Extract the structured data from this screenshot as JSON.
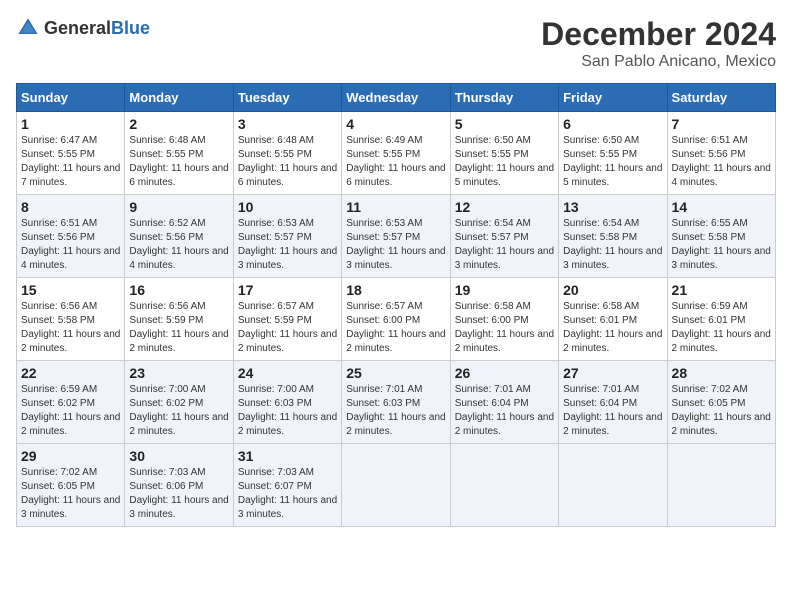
{
  "header": {
    "logo_general": "General",
    "logo_blue": "Blue",
    "month_title": "December 2024",
    "location": "San Pablo Anicano, Mexico"
  },
  "calendar": {
    "days_of_week": [
      "Sunday",
      "Monday",
      "Tuesday",
      "Wednesday",
      "Thursday",
      "Friday",
      "Saturday"
    ],
    "weeks": [
      [
        {
          "day": "1",
          "sunrise": "6:47 AM",
          "sunset": "5:55 PM",
          "daylight": "11 hours and 7 minutes."
        },
        {
          "day": "2",
          "sunrise": "6:48 AM",
          "sunset": "5:55 PM",
          "daylight": "11 hours and 6 minutes."
        },
        {
          "day": "3",
          "sunrise": "6:48 AM",
          "sunset": "5:55 PM",
          "daylight": "11 hours and 6 minutes."
        },
        {
          "day": "4",
          "sunrise": "6:49 AM",
          "sunset": "5:55 PM",
          "daylight": "11 hours and 6 minutes."
        },
        {
          "day": "5",
          "sunrise": "6:50 AM",
          "sunset": "5:55 PM",
          "daylight": "11 hours and 5 minutes."
        },
        {
          "day": "6",
          "sunrise": "6:50 AM",
          "sunset": "5:55 PM",
          "daylight": "11 hours and 5 minutes."
        },
        {
          "day": "7",
          "sunrise": "6:51 AM",
          "sunset": "5:56 PM",
          "daylight": "11 hours and 4 minutes."
        }
      ],
      [
        {
          "day": "8",
          "sunrise": "6:51 AM",
          "sunset": "5:56 PM",
          "daylight": "11 hours and 4 minutes."
        },
        {
          "day": "9",
          "sunrise": "6:52 AM",
          "sunset": "5:56 PM",
          "daylight": "11 hours and 4 minutes."
        },
        {
          "day": "10",
          "sunrise": "6:53 AM",
          "sunset": "5:57 PM",
          "daylight": "11 hours and 3 minutes."
        },
        {
          "day": "11",
          "sunrise": "6:53 AM",
          "sunset": "5:57 PM",
          "daylight": "11 hours and 3 minutes."
        },
        {
          "day": "12",
          "sunrise": "6:54 AM",
          "sunset": "5:57 PM",
          "daylight": "11 hours and 3 minutes."
        },
        {
          "day": "13",
          "sunrise": "6:54 AM",
          "sunset": "5:58 PM",
          "daylight": "11 hours and 3 minutes."
        },
        {
          "day": "14",
          "sunrise": "6:55 AM",
          "sunset": "5:58 PM",
          "daylight": "11 hours and 3 minutes."
        }
      ],
      [
        {
          "day": "15",
          "sunrise": "6:56 AM",
          "sunset": "5:58 PM",
          "daylight": "11 hours and 2 minutes."
        },
        {
          "day": "16",
          "sunrise": "6:56 AM",
          "sunset": "5:59 PM",
          "daylight": "11 hours and 2 minutes."
        },
        {
          "day": "17",
          "sunrise": "6:57 AM",
          "sunset": "5:59 PM",
          "daylight": "11 hours and 2 minutes."
        },
        {
          "day": "18",
          "sunrise": "6:57 AM",
          "sunset": "6:00 PM",
          "daylight": "11 hours and 2 minutes."
        },
        {
          "day": "19",
          "sunrise": "6:58 AM",
          "sunset": "6:00 PM",
          "daylight": "11 hours and 2 minutes."
        },
        {
          "day": "20",
          "sunrise": "6:58 AM",
          "sunset": "6:01 PM",
          "daylight": "11 hours and 2 minutes."
        },
        {
          "day": "21",
          "sunrise": "6:59 AM",
          "sunset": "6:01 PM",
          "daylight": "11 hours and 2 minutes."
        }
      ],
      [
        {
          "day": "22",
          "sunrise": "6:59 AM",
          "sunset": "6:02 PM",
          "daylight": "11 hours and 2 minutes."
        },
        {
          "day": "23",
          "sunrise": "7:00 AM",
          "sunset": "6:02 PM",
          "daylight": "11 hours and 2 minutes."
        },
        {
          "day": "24",
          "sunrise": "7:00 AM",
          "sunset": "6:03 PM",
          "daylight": "11 hours and 2 minutes."
        },
        {
          "day": "25",
          "sunrise": "7:01 AM",
          "sunset": "6:03 PM",
          "daylight": "11 hours and 2 minutes."
        },
        {
          "day": "26",
          "sunrise": "7:01 AM",
          "sunset": "6:04 PM",
          "daylight": "11 hours and 2 minutes."
        },
        {
          "day": "27",
          "sunrise": "7:01 AM",
          "sunset": "6:04 PM",
          "daylight": "11 hours and 2 minutes."
        },
        {
          "day": "28",
          "sunrise": "7:02 AM",
          "sunset": "6:05 PM",
          "daylight": "11 hours and 2 minutes."
        }
      ],
      [
        {
          "day": "29",
          "sunrise": "7:02 AM",
          "sunset": "6:05 PM",
          "daylight": "11 hours and 3 minutes."
        },
        {
          "day": "30",
          "sunrise": "7:03 AM",
          "sunset": "6:06 PM",
          "daylight": "11 hours and 3 minutes."
        },
        {
          "day": "31",
          "sunrise": "7:03 AM",
          "sunset": "6:07 PM",
          "daylight": "11 hours and 3 minutes."
        },
        null,
        null,
        null,
        null
      ]
    ]
  }
}
